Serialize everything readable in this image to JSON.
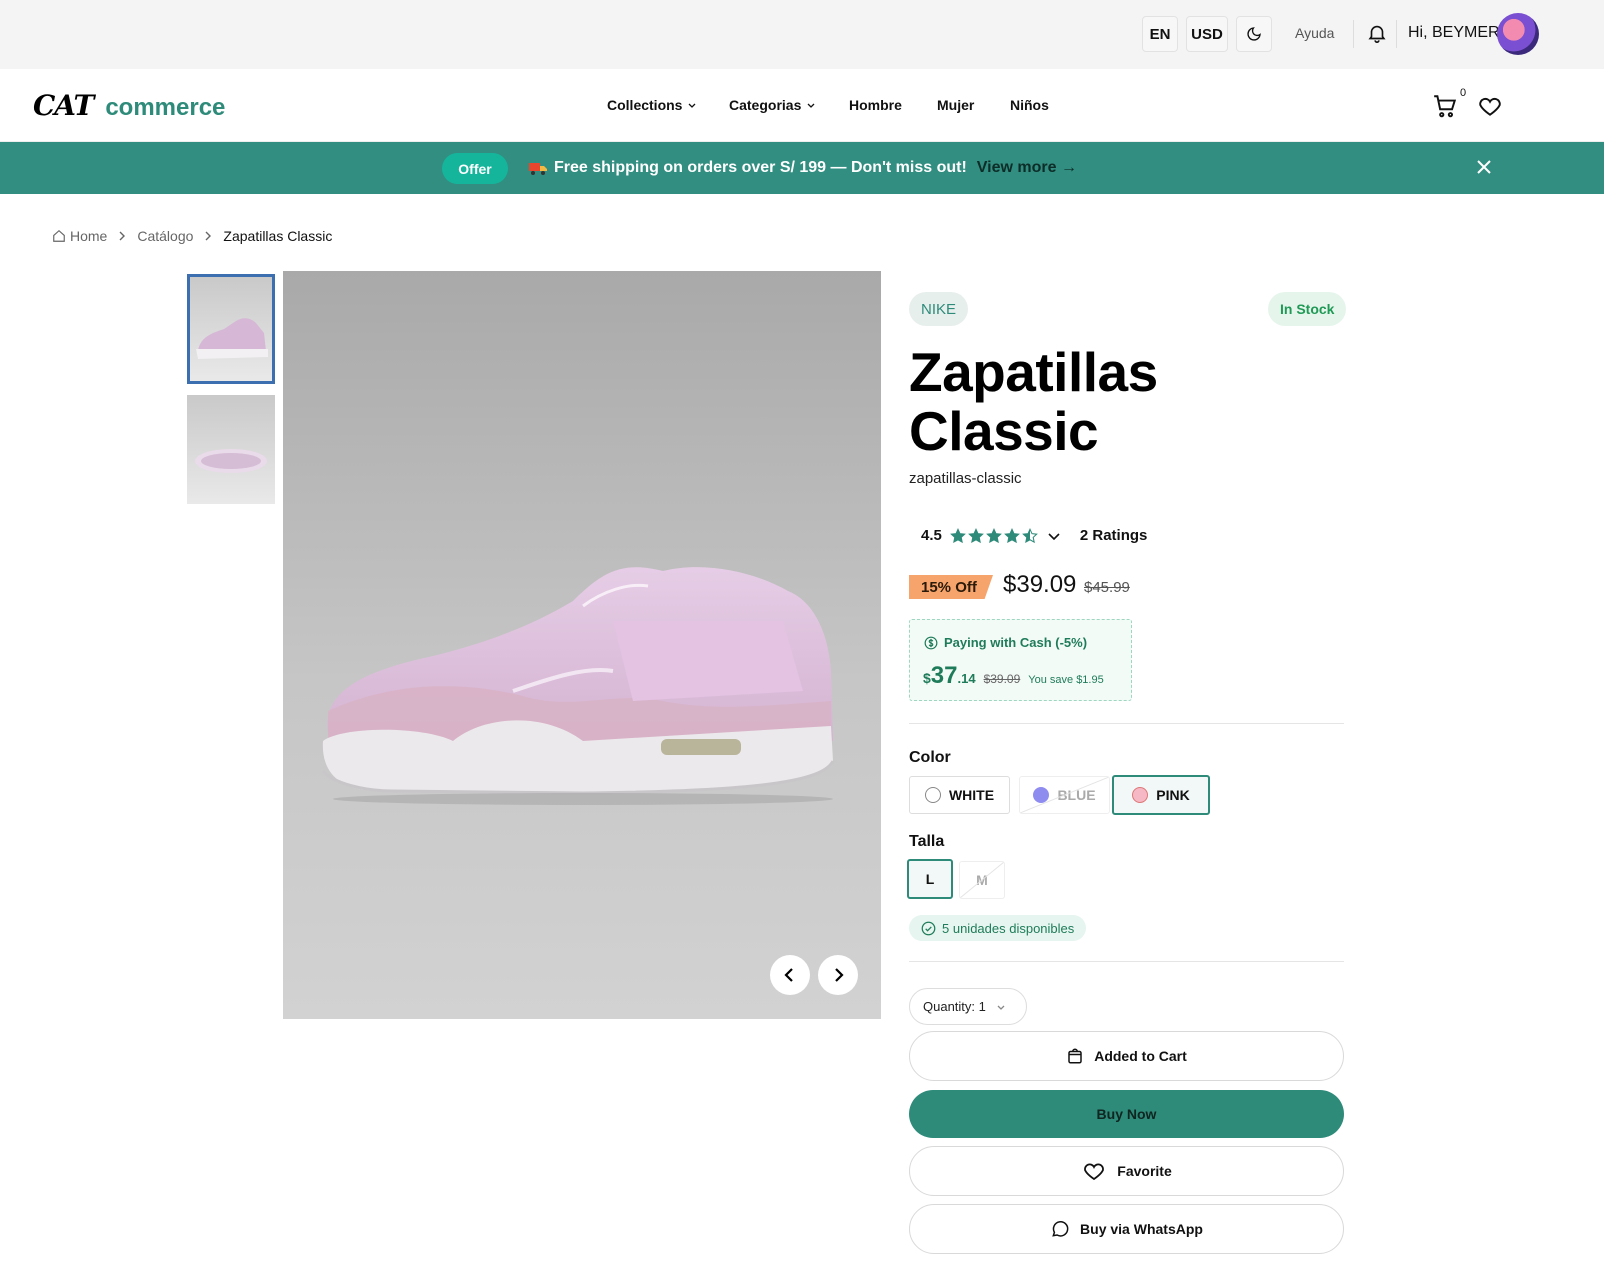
{
  "topbar": {
    "lang": "EN",
    "currency": "USD",
    "help": "Ayuda",
    "greeting": "Hi, BEYMER"
  },
  "header": {
    "logo_mark": "CAT",
    "logo_text": "commerce",
    "nav": [
      {
        "label": "Collections",
        "dropdown": true
      },
      {
        "label": "Categorias",
        "dropdown": true
      },
      {
        "label": "Hombre",
        "dropdown": false
      },
      {
        "label": "Mujer",
        "dropdown": false
      },
      {
        "label": "Niños",
        "dropdown": false
      }
    ],
    "cart_count": "0"
  },
  "promo": {
    "badge": "Offer",
    "text": "Free shipping on orders over S/ 199 — Don't miss out!",
    "link": "View more →"
  },
  "breadcrumb": {
    "home": "Home",
    "catalog": "Catálogo",
    "current": "Zapatillas Classic"
  },
  "product": {
    "brand": "NIKE",
    "stock": "In Stock",
    "title": "Zapatillas Classic",
    "slug": "zapatillas-classic",
    "rating": "4.5",
    "rating_value": 4.5,
    "ratings_count": "2 Ratings",
    "discount": "15% Off",
    "price": "$39.09",
    "old_price": "$45.99",
    "cash": {
      "heading": "Paying with Cash (-5%)",
      "currency": "$",
      "integer": "37",
      "decimals": ".14",
      "old": "$39.09",
      "save": "You save $1.95"
    },
    "color_label": "Color",
    "colors": [
      {
        "label": "WHITE",
        "swatch": "#ffffff",
        "state": "available"
      },
      {
        "label": "BLUE",
        "swatch": "#8f8cf0",
        "state": "disabled"
      },
      {
        "label": "PINK",
        "swatch": "#f5b8c4",
        "state": "selected"
      }
    ],
    "size_label": "Talla",
    "sizes": [
      {
        "label": "L",
        "state": "selected"
      },
      {
        "label": "M",
        "state": "disabled"
      }
    ],
    "availability": "5 unidades disponibles",
    "quantity": "Quantity: 1",
    "buttons": {
      "cart": "Added to Cart",
      "buy": "Buy Now",
      "favorite": "Favorite",
      "whatsapp": "Buy via WhatsApp"
    }
  },
  "colors": {
    "accent": "#2e8b7a",
    "promo_bg": "#328e80",
    "offer_badge": "#15b59c",
    "discount_tag": "#f6a46b",
    "in_stock": "#1f9a55"
  },
  "icons": [
    "theme-moon-icon",
    "bell-icon",
    "cart-icon",
    "heart-icon",
    "truck-icon",
    "close-icon",
    "home-icon",
    "chevron-right-icon",
    "star-icon",
    "chevron-down-icon",
    "dollar-circle-icon",
    "check-circle-icon",
    "bag-icon",
    "chat-icon",
    "arrow-left-icon",
    "arrow-right-icon"
  ]
}
